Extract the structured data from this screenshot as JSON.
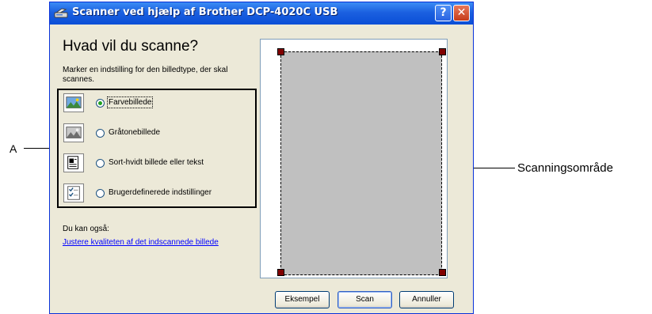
{
  "window": {
    "title": "Scanner ved hjælp af Brother DCP-4020C USB",
    "help_symbol": "?",
    "close_symbol": "✕"
  },
  "heading": "Hvad vil du scanne?",
  "instructions": "Marker en indstilling for den billedtype, der skal scannes.",
  "options": [
    {
      "label": "Farvebillede",
      "selected": true,
      "icon": "color-picture-icon"
    },
    {
      "label": "Gråtonebillede",
      "selected": false,
      "icon": "grayscale-picture-icon"
    },
    {
      "label": "Sort-hvidt billede eller tekst",
      "selected": false,
      "icon": "bw-text-icon"
    },
    {
      "label": "Brugerdefinerede indstillinger",
      "selected": false,
      "icon": "custom-settings-icon"
    }
  ],
  "also": {
    "label": "Du kan også:",
    "link": "Justere kvaliteten af det indscannede billede"
  },
  "buttons": {
    "preview": "Eksempel",
    "scan": "Scan",
    "cancel": "Annuller"
  },
  "annotations": {
    "a": "A",
    "scan_area": "Scanningsområde"
  },
  "colors": {
    "titlebar": "#0a4ed6",
    "scan_area": "#c0c0c0",
    "handle": "#800000",
    "link": "#0000ff"
  }
}
